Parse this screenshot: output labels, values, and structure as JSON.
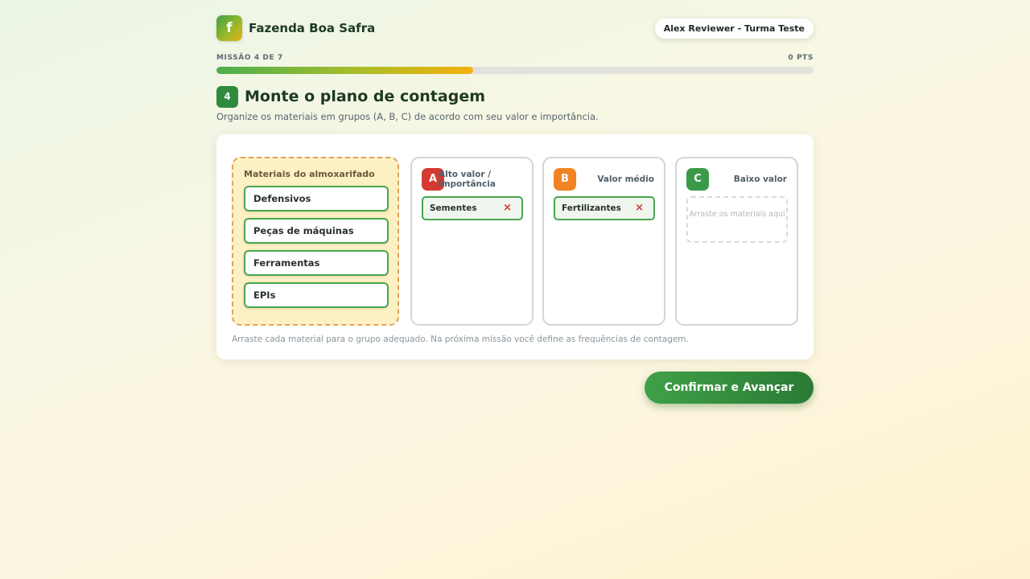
{
  "brand": {
    "logo_letter": "f",
    "name": "Fazenda Boa Safra"
  },
  "user": {
    "label": "Alex Reviewer - Turma Teste"
  },
  "progress": {
    "label": "MISSÃO 4 DE 7",
    "points": "0 PTS",
    "fraction": 0.43
  },
  "step": {
    "number": "4",
    "title": "Monte o plano de contagem",
    "subtitle": "Organize os materiais em grupos (A, B, C) de acordo com seu valor e importância."
  },
  "pool": {
    "title": "Materiais do almoxarifado",
    "items": [
      "Defensivos",
      "Peças de máquinas",
      "Ferramentas",
      "EPIs"
    ]
  },
  "groups": [
    {
      "letter": "A",
      "name": "Alto valor / importância",
      "color": "#d33a32",
      "items": [
        {
          "label": "Sementes",
          "remove": "×"
        }
      ]
    },
    {
      "letter": "B",
      "name": "Valor médio",
      "color": "#f08322",
      "items": [
        {
          "label": "Fertilizantes",
          "remove": "×"
        }
      ]
    },
    {
      "letter": "C",
      "name": "Baixo valor",
      "color": "#3b9a4a",
      "items": [],
      "placeholder": "Arraste os materiais aqui"
    }
  ],
  "hint": "Arraste cada material para o grupo adequado. Na próxima missão você define as frequências de contagem.",
  "confirm_label": "Confirmar e Avançar"
}
